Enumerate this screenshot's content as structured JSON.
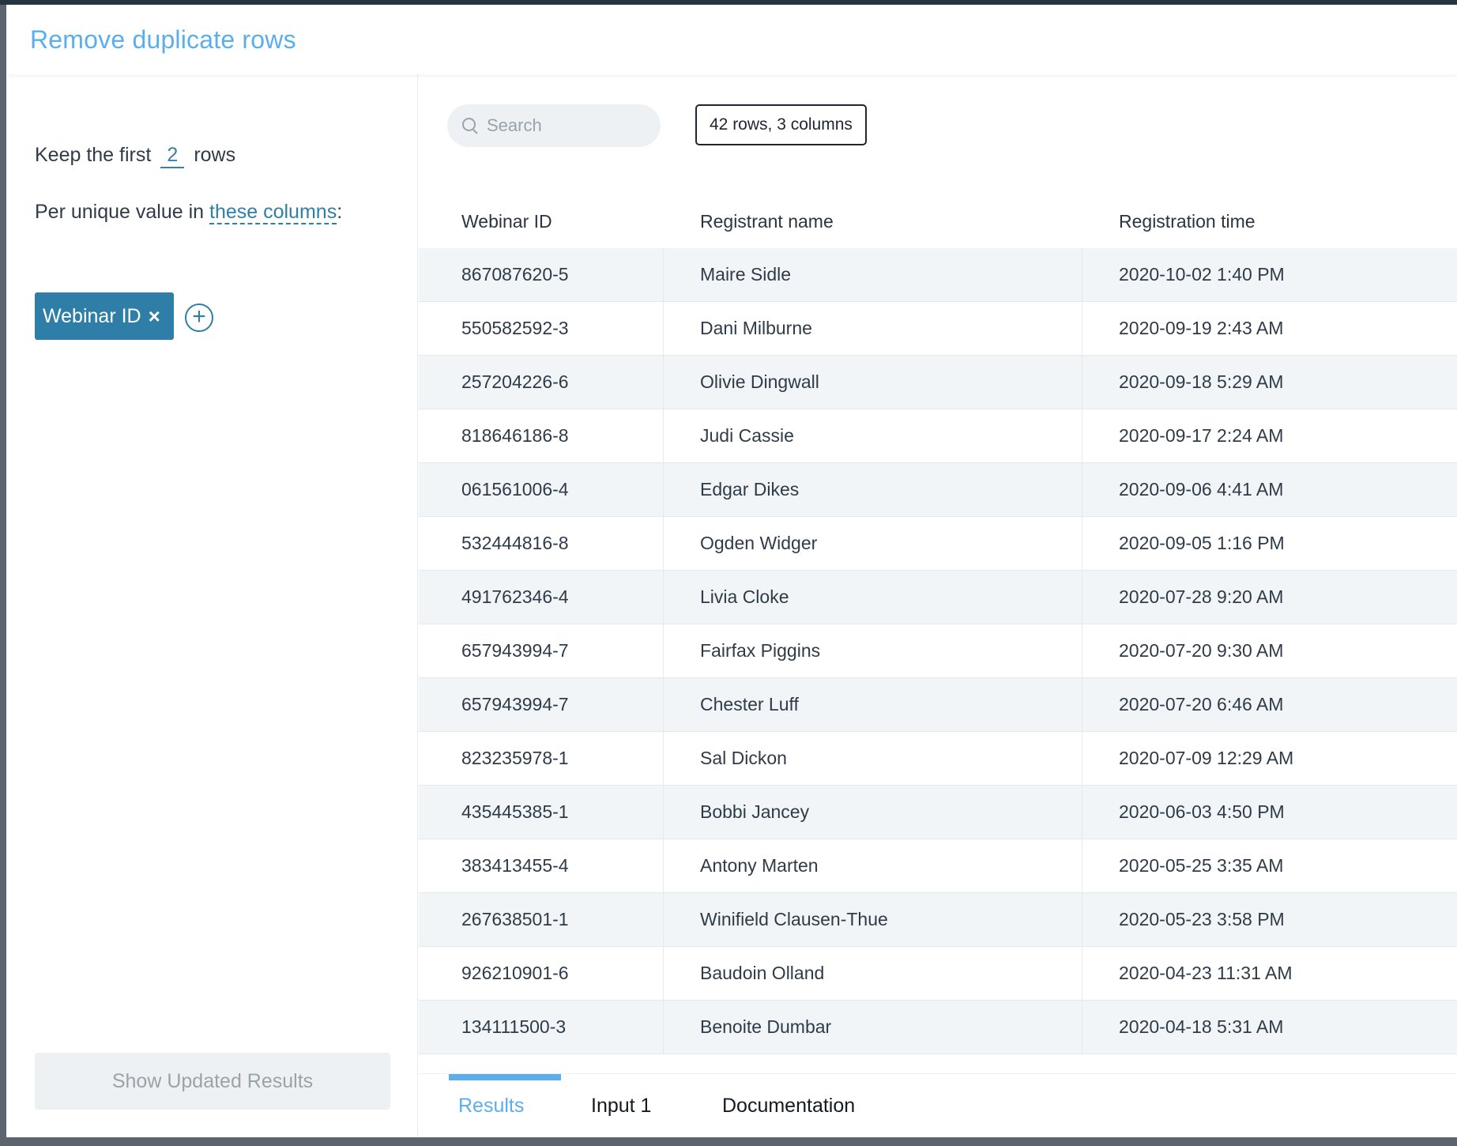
{
  "modal": {
    "title": "Remove duplicate rows"
  },
  "left": {
    "keep_prefix": "Keep the first",
    "keep_count": "2",
    "keep_suffix": "rows",
    "per_prefix": "Per unique value in",
    "per_link": "these columns",
    "per_suffix": ":",
    "chips": [
      {
        "label": "Webinar ID",
        "remove": "×"
      }
    ],
    "add_symbol": "+",
    "show_button": "Show Updated Results"
  },
  "right": {
    "search_placeholder": "Search",
    "counts": "42 rows, 3 columns",
    "columns": [
      "Webinar ID",
      "Registrant name",
      "Registration time"
    ],
    "rows": [
      [
        "867087620-5",
        "Maire Sidle",
        "2020-10-02 1:40 PM"
      ],
      [
        "550582592-3",
        "Dani Milburne",
        "2020-09-19 2:43 AM"
      ],
      [
        "257204226-6",
        "Olivie Dingwall",
        "2020-09-18 5:29 AM"
      ],
      [
        "818646186-8",
        "Judi Cassie",
        "2020-09-17 2:24 AM"
      ],
      [
        "061561006-4",
        "Edgar Dikes",
        "2020-09-06 4:41 AM"
      ],
      [
        "532444816-8",
        "Ogden Widger",
        "2020-09-05 1:16 PM"
      ],
      [
        "491762346-4",
        "Livia Cloke",
        "2020-07-28 9:20 AM"
      ],
      [
        "657943994-7",
        "Fairfax Piggins",
        "2020-07-20 9:30 AM"
      ],
      [
        "657943994-7",
        "Chester Luff",
        "2020-07-20 6:46 AM"
      ],
      [
        "823235978-1",
        "Sal Dickon",
        "2020-07-09 12:29 AM"
      ],
      [
        "435445385-1",
        "Bobbi Jancey",
        "2020-06-03 4:50 PM"
      ],
      [
        "383413455-4",
        "Antony Marten",
        "2020-05-25 3:35 AM"
      ],
      [
        "267638501-1",
        "Winifield Clausen-Thue",
        "2020-05-23 3:58 PM"
      ],
      [
        "926210901-6",
        "Baudoin Olland",
        "2020-04-23 11:31 AM"
      ],
      [
        "134111500-3",
        "Benoite Dumbar",
        "2020-04-18 5:31 AM"
      ]
    ],
    "tabs": [
      "Results",
      "Input 1",
      "Documentation"
    ],
    "active_tab": "Results"
  },
  "colors": {
    "accent": "#5aaef0",
    "chip": "#2f7ea8",
    "link": "#2e7fa6"
  }
}
